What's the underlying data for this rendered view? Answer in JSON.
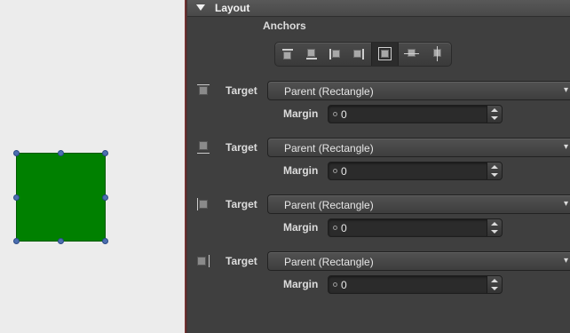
{
  "section": {
    "title": "Layout"
  },
  "anchors": {
    "label": "Anchors",
    "toolbar": [
      {
        "icon": "anchor-top-icon"
      },
      {
        "icon": "anchor-bottom-icon"
      },
      {
        "icon": "anchor-left-icon"
      },
      {
        "icon": "anchor-right-icon"
      },
      {
        "icon": "anchor-fill-icon"
      },
      {
        "icon": "anchor-vertical-center-icon"
      },
      {
        "icon": "anchor-horizontal-center-icon"
      }
    ]
  },
  "rows": [
    {
      "target_label": "Target",
      "target_value": "Parent (Rectangle)",
      "margin_label": "Margin",
      "margin_value": "0",
      "icon": "anchor-top-icon"
    },
    {
      "target_label": "Target",
      "target_value": "Parent (Rectangle)",
      "margin_label": "Margin",
      "margin_value": "0",
      "icon": "anchor-bottom-icon"
    },
    {
      "target_label": "Target",
      "target_value": "Parent (Rectangle)",
      "margin_label": "Margin",
      "margin_value": "0",
      "icon": "anchor-left-icon"
    },
    {
      "target_label": "Target",
      "target_value": "Parent (Rectangle)",
      "margin_label": "Margin",
      "margin_value": "0",
      "icon": "anchor-right-icon"
    }
  ],
  "colors": {
    "rectangle_fill": "#008000",
    "panel_bg": "#3f3f3f",
    "canvas_bg": "#ececec",
    "handle": "#4c6fb0"
  }
}
